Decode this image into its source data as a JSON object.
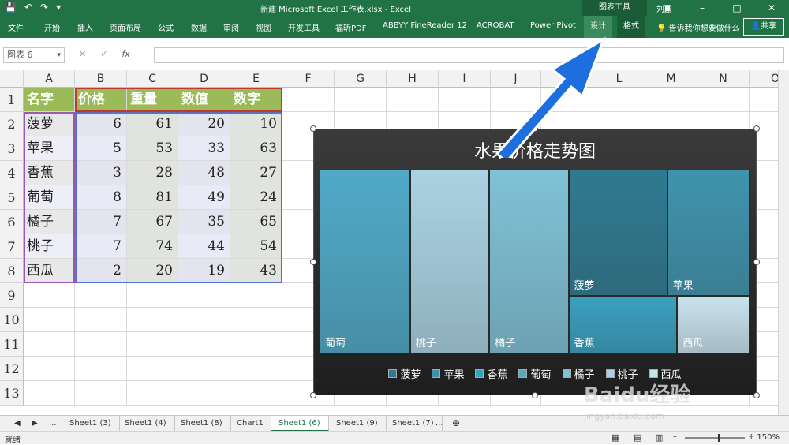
{
  "titlebar": {
    "title": "新建 Microsoft Excel 工作表.xlsx - Excel",
    "context_label": "图表工具",
    "user": "刘东"
  },
  "ribbon": {
    "tabs": [
      "文件",
      "开始",
      "插入",
      "页面布局",
      "公式",
      "数据",
      "审阅",
      "视图",
      "开发工具",
      "福昕PDF",
      "ABBYY FineReader 12",
      "ACROBAT",
      "Power Pivot"
    ],
    "ctx_tabs": [
      "设计",
      "格式"
    ],
    "tell_me": "告诉我你想要做什么",
    "share": "共享"
  },
  "formula_bar": {
    "name_box": "图表 6",
    "fx_label": "fx",
    "formula": ""
  },
  "sheet": {
    "columns": [
      "A",
      "B",
      "C",
      "D",
      "E",
      "F",
      "G",
      "H",
      "I",
      "J",
      "K",
      "L",
      "M",
      "N",
      "O"
    ],
    "rows": [
      "1",
      "2",
      "3",
      "4",
      "5",
      "6",
      "7",
      "8",
      "9",
      "10",
      "11",
      "12",
      "13"
    ],
    "headers": [
      "名字",
      "价格",
      "重量",
      "数值",
      "数字"
    ],
    "data": [
      [
        "菠萝",
        "6",
        "61",
        "20",
        "10"
      ],
      [
        "苹果",
        "5",
        "53",
        "33",
        "63"
      ],
      [
        "香蕉",
        "3",
        "28",
        "48",
        "27"
      ],
      [
        "葡萄",
        "8",
        "81",
        "49",
        "24"
      ],
      [
        "橘子",
        "7",
        "67",
        "35",
        "65"
      ],
      [
        "桃子",
        "7",
        "74",
        "44",
        "54"
      ],
      [
        "西瓜",
        "2",
        "20",
        "19",
        "43"
      ]
    ]
  },
  "chart_data": {
    "type": "treemap",
    "title": "水果价格走势图",
    "categories": [
      "菠萝",
      "苹果",
      "香蕉",
      "葡萄",
      "橘子",
      "桃子",
      "西瓜"
    ],
    "values": [
      6,
      5,
      3,
      8,
      7,
      7,
      2
    ],
    "legend": "bottom",
    "colors": {
      "葡萄": "#4fa9c7",
      "桃子": "#a9d2e2",
      "橘子": "#7fc1d6",
      "菠萝": "#2f7a91",
      "苹果": "#3f93ad",
      "香蕉": "#3aa0bf",
      "西瓜": "#c8e2ec"
    }
  },
  "sheet_tabs": [
    "Sheet1 (3)",
    "Sheet1 (4)",
    "Sheet1 (8)",
    "Chart1",
    "Sheet1 (6)",
    "Sheet1 (9)",
    "Sheet1 (7)"
  ],
  "active_tab": "Sheet1 (6)",
  "sheet_nav": {
    "prev": "◀",
    "next": "▶",
    "more": "...",
    "more_right": "...",
    "add": "⊕"
  },
  "status": {
    "ready": "就绪",
    "zoom": "150%"
  },
  "watermark": {
    "text": "Baidu经验",
    "url": "jingyan.baidu.com"
  }
}
